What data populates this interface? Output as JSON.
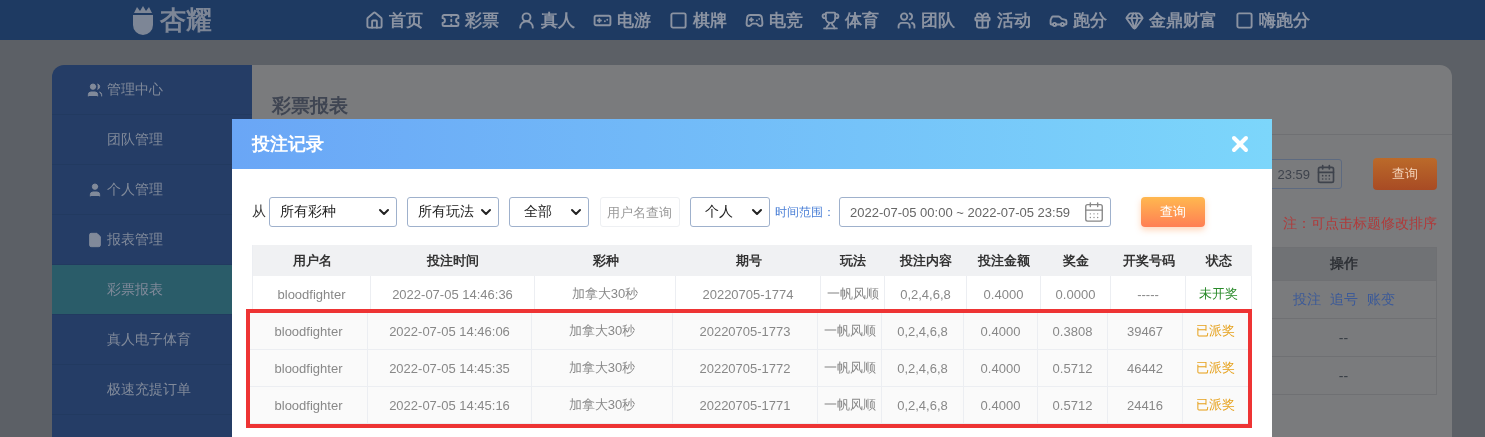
{
  "header": {
    "logo": "杏耀",
    "nav": [
      {
        "label": "首页"
      },
      {
        "label": "彩票"
      },
      {
        "label": "真人"
      },
      {
        "label": "电游"
      },
      {
        "label": "棋牌"
      },
      {
        "label": "电竞"
      },
      {
        "label": "体育"
      },
      {
        "label": "团队"
      },
      {
        "label": "活动"
      },
      {
        "label": "跑分"
      },
      {
        "label": "金鼎财富"
      },
      {
        "label": "嗨跑分"
      }
    ]
  },
  "sidebar": {
    "items": [
      {
        "label": "管理中心",
        "kind": "section",
        "selected": false
      },
      {
        "label": "团队管理",
        "kind": "link",
        "selected": false
      },
      {
        "label": "个人管理",
        "kind": "section",
        "selected": false
      },
      {
        "label": "报表管理",
        "kind": "section",
        "selected": false
      },
      {
        "label": "彩票报表",
        "kind": "link",
        "selected": true
      },
      {
        "label": "真人电子体育",
        "kind": "link",
        "selected": false
      },
      {
        "label": "极速充提订单",
        "kind": "link",
        "selected": false
      }
    ]
  },
  "page": {
    "title": "彩票报表",
    "date_value": "23:59",
    "query_button": "查询",
    "note": "注：可点击标题修改排序",
    "table": {
      "column": "操作",
      "rows": [
        {
          "kind": "actions",
          "links": [
            "投注",
            "追号",
            "账变"
          ]
        },
        {
          "kind": "text",
          "text": "--"
        },
        {
          "kind": "text",
          "text": "--"
        }
      ]
    }
  },
  "modal": {
    "title": "投注记录",
    "filters": {
      "from_label": "从",
      "selects": [
        {
          "value": "所有彩种"
        },
        {
          "value": "所有玩法"
        },
        {
          "value": "全部"
        }
      ],
      "username": {
        "placeholder": "用户名查询"
      },
      "scope": {
        "value": "个人"
      },
      "time_label": "时间范围：",
      "date_range": "2022-07-05 00:00 ~ 2022-07-05 23:59",
      "query_button": "查询"
    },
    "table": {
      "columns": [
        "用户名",
        "投注时间",
        "彩种",
        "期号",
        "玩法",
        "投注内容",
        "投注金额",
        "奖金",
        "开奖号码",
        "状态"
      ],
      "rows": [
        {
          "cells": [
            "bloodfighter",
            "2022-07-05 14:46:36",
            "加拿大30秒",
            "20220705-1774",
            "一帆风顺",
            "0,2,4,6,8",
            "0.4000",
            "0.0000",
            "-----"
          ],
          "status": "未开奖",
          "kind": "pending",
          "highlighted": false
        },
        {
          "cells": [
            "bloodfighter",
            "2022-07-05 14:46:06",
            "加拿大30秒",
            "20220705-1773",
            "一帆风顺",
            "0,2,4,6,8",
            "0.4000",
            "0.3808",
            "39467"
          ],
          "status": "已派奖",
          "kind": "paid",
          "highlighted": true
        },
        {
          "cells": [
            "bloodfighter",
            "2022-07-05 14:45:35",
            "加拿大30秒",
            "20220705-1772",
            "一帆风顺",
            "0,2,4,6,8",
            "0.4000",
            "0.5712",
            "46442"
          ],
          "status": "已派奖",
          "kind": "paid",
          "highlighted": true
        },
        {
          "cells": [
            "bloodfighter",
            "2022-07-05 14:45:16",
            "加拿大30秒",
            "20220705-1771",
            "一帆风顺",
            "0,2,4,6,8",
            "0.4000",
            "0.5712",
            "24416"
          ],
          "status": "已派奖",
          "kind": "paid",
          "highlighted": true
        }
      ]
    }
  }
}
